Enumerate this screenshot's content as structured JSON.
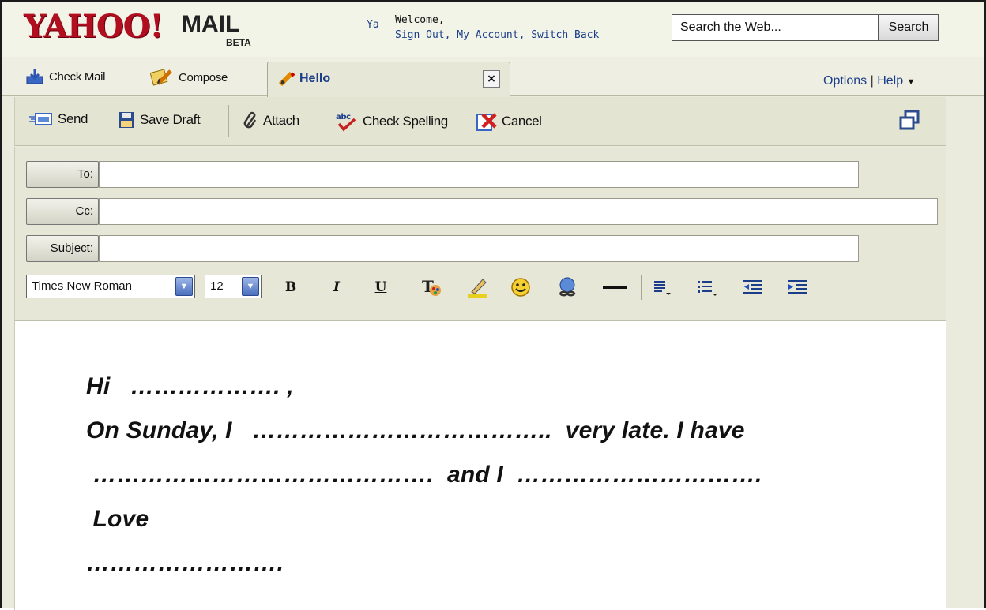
{
  "header": {
    "logo_yahoo": "YAHOO!",
    "logo_mail": "MAIL",
    "logo_beta": "BETA",
    "welcome_prefix": "Ya",
    "welcome": "Welcome,",
    "links": [
      "Sign Out",
      "My Account",
      "Switch Back"
    ],
    "search_placeholder": "Search the Web...",
    "search_button": "Search"
  },
  "tabs": {
    "check_mail": "Check Mail",
    "compose": "Compose",
    "active_tab": "Hello",
    "close": "×",
    "options": "Options",
    "help": "Help"
  },
  "toolbar": {
    "send": "Send",
    "save_draft": "Save Draft",
    "attach": "Attach",
    "check_spelling": "Check Spelling",
    "cancel": "Cancel"
  },
  "form": {
    "to_label": "To:",
    "cc_label": "Cc:",
    "subject_label": "Subject:",
    "to_value": "",
    "cc_value": "",
    "subject_value": "",
    "font_family": "Times New Roman",
    "font_size": "12",
    "bold": "B",
    "italic": "I",
    "underline": "U"
  },
  "message": {
    "lines": [
      "Hi   ………………. ,",
      "On Sunday, I   ………………………………..  very late. I have",
      " …………………………………….  and I  ………………………….",
      " Love",
      "……………………."
    ]
  }
}
